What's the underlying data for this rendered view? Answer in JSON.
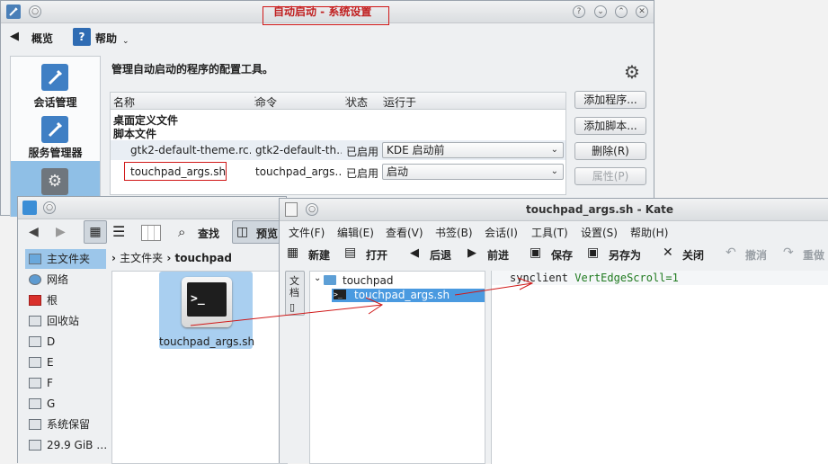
{
  "settings": {
    "title": "自动启动 - 系统设置",
    "overview": "概览",
    "help": "帮助",
    "description": "管理自动启动的程序的配置工具。",
    "sidebar": [
      {
        "label": "会话管理",
        "icon": "session-icon"
      },
      {
        "label": "服务管理器",
        "icon": "service-icon"
      }
    ],
    "columns": [
      "名称",
      "命令",
      "状态",
      "运行于"
    ],
    "groups": [
      "桌面定义文件",
      "脚本文件"
    ],
    "rows": [
      {
        "name": "gtk2-default-theme.rc…",
        "command": "gtk2-default-th…",
        "status": "已启用",
        "run_at": "KDE 启动前"
      },
      {
        "name": "touchpad_args.sh",
        "command": "touchpad_args…",
        "status": "已启用",
        "run_at": "启动"
      }
    ],
    "buttons": {
      "add_program": "添加程序...",
      "add_script": "添加脚本...",
      "delete": "删除(R)",
      "properties": "属性(P)"
    }
  },
  "dolphin": {
    "toolbar": {
      "find": "查找",
      "preview": "预览"
    },
    "breadcrumb": [
      "主文件夹",
      "touchpad"
    ],
    "places": [
      "主文件夹",
      "网络",
      "根",
      "回收站",
      "D",
      "E",
      "F",
      "G",
      "系统保留",
      "29.9 GiB …"
    ],
    "file": {
      "name": "touchpad_args.sh"
    }
  },
  "kate": {
    "title": "touchpad_args.sh - Kate",
    "menu": [
      "文件(F)",
      "编辑(E)",
      "查看(V)",
      "书签(B)",
      "会话(I)",
      "工具(T)",
      "设置(S)",
      "帮助(H)"
    ],
    "toolbar": {
      "new": "新建",
      "open": "打开",
      "back": "后退",
      "forward": "前进",
      "save": "保存",
      "save_as": "另存为",
      "close": "关闭",
      "undo": "撤消",
      "redo": "重做"
    },
    "side_tab": "文档",
    "tree": {
      "folder": "touchpad",
      "file": "touchpad_args.sh"
    },
    "code": {
      "command": "synclient",
      "arg": "VertEdgeScroll=1"
    }
  },
  "colors": {
    "accent": "#3b8ed6",
    "selection": "#4a9ae0",
    "annotation": "#d01818",
    "code_arg": "#1f7a1f"
  }
}
